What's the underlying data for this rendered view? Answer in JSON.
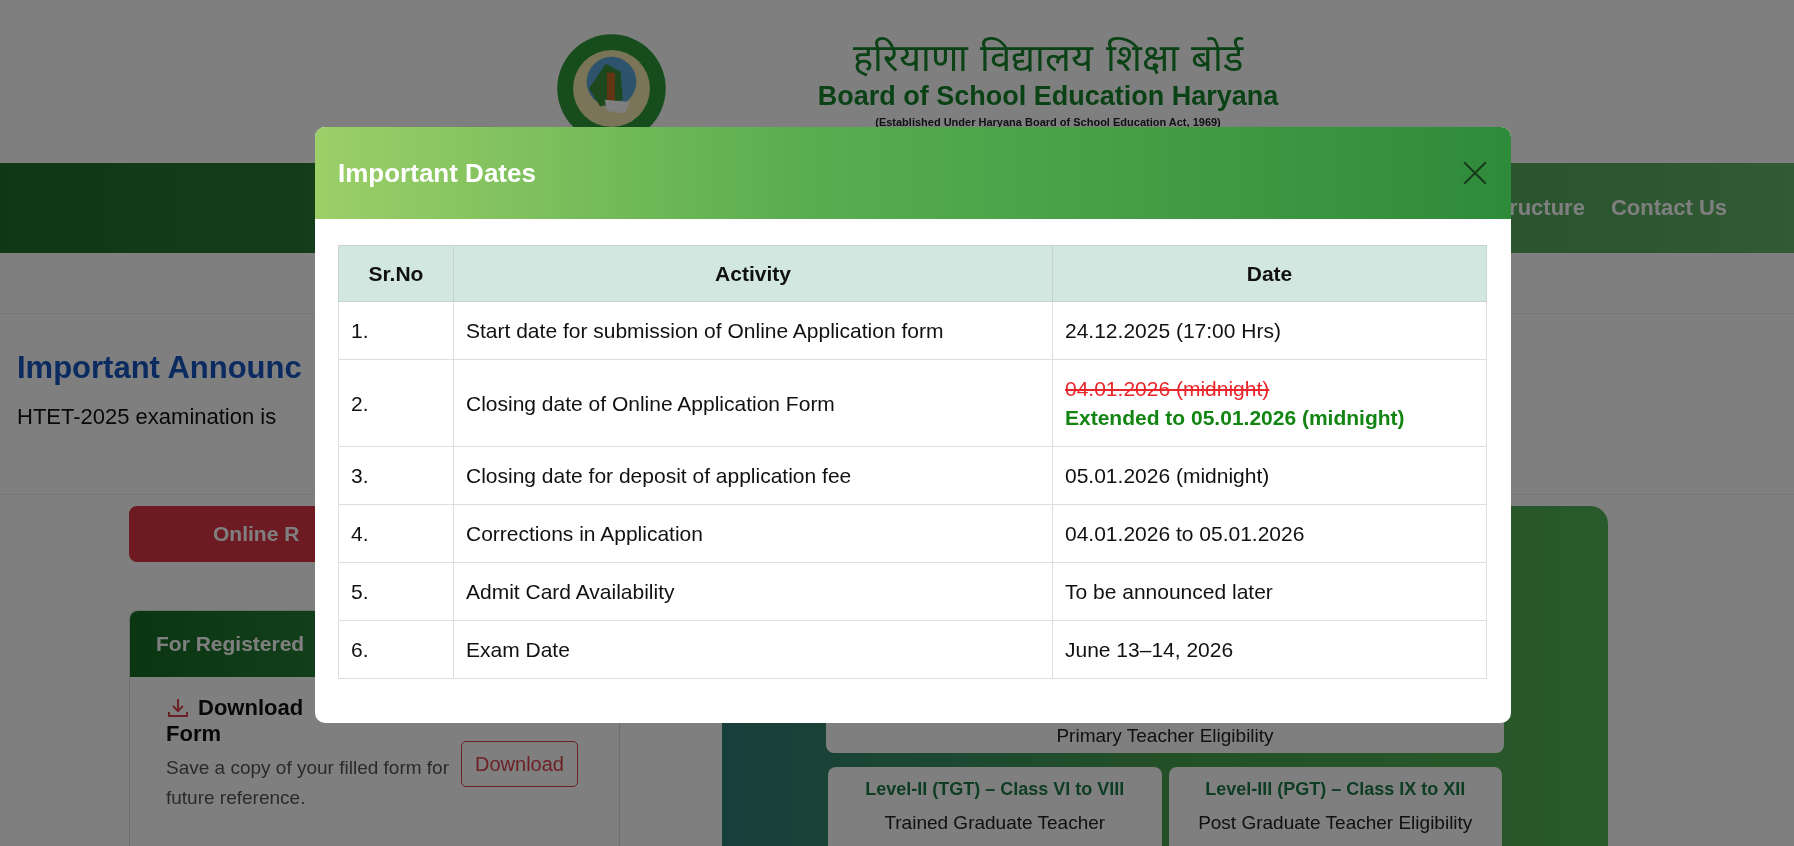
{
  "header": {
    "title_hindi": "हरियाणा विद्यालय शिक्षा बोर्ड",
    "title_english": "Board of School Education Haryana",
    "subtitle": "(Established Under Haryana Board of School Education Act, 1969)"
  },
  "nav": {
    "items": [
      "ructure",
      "Contact Us"
    ]
  },
  "announcement": {
    "title": "Important Announc",
    "text": "HTET-2025 examination is"
  },
  "register_button": "Online R",
  "registered_card": {
    "title": "For Registered",
    "item_title": [
      "Download",
      "Form"
    ],
    "description": "Save a copy of your filled form for future reference.",
    "button": "Download"
  },
  "levels_panel": {
    "primary_text": "Primary Teacher Eligibility",
    "cards": [
      {
        "title": "Level-II (TGT) – Class VI to VIII",
        "text": "Trained Graduate Teacher"
      },
      {
        "title": "Level-III (PGT) – Class IX to XII",
        "text": "Post Graduate Teacher Eligibility"
      }
    ]
  },
  "modal": {
    "title": "Important Dates",
    "columns": [
      "Sr.No",
      "Activity",
      "Date"
    ],
    "rows": [
      {
        "sr": "1.",
        "activity": "Start date for submission of Online Application form",
        "dates": [
          {
            "kind": "plain",
            "text": "24.12.2025 (17:00 Hrs)"
          }
        ]
      },
      {
        "sr": "2.",
        "activity": "Closing date of Online Application Form",
        "dates": [
          {
            "kind": "struck",
            "text": "04.01.2026 (midnight)"
          },
          {
            "kind": "extended",
            "text": "Extended to 05.01.2026 (midnight)"
          }
        ]
      },
      {
        "sr": "3.",
        "activity": "Closing date for deposit of application fee",
        "dates": [
          {
            "kind": "plain",
            "text": "05.01.2026 (midnight)"
          }
        ]
      },
      {
        "sr": "4.",
        "activity": "Corrections in Application",
        "dates": [
          {
            "kind": "plain",
            "text": "04.01.2026 to 05.01.2026"
          }
        ]
      },
      {
        "sr": "5.",
        "activity": "Admit Card Availability",
        "dates": [
          {
            "kind": "plain",
            "text": "To be announced later"
          }
        ]
      },
      {
        "sr": "6.",
        "activity": "Exam Date",
        "dates": [
          {
            "kind": "plain",
            "text": "June 13–14, 2026"
          }
        ]
      }
    ]
  }
}
